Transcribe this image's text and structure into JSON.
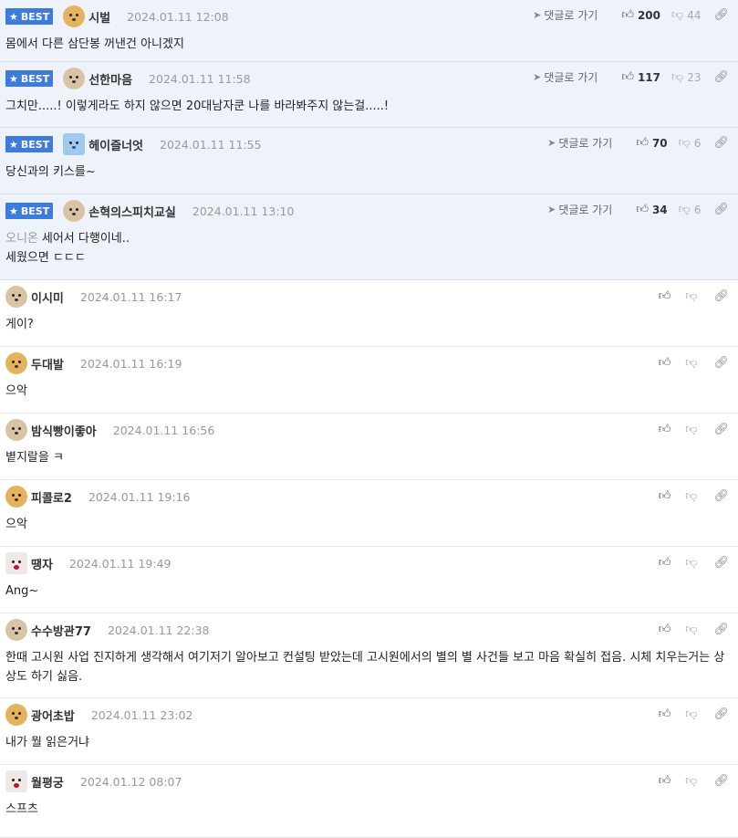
{
  "best_label": "BEST",
  "reply_label": "댓글로 가기",
  "comments": [
    {
      "best": true,
      "nick": "시벌",
      "date": "2024.01.11 12:08",
      "up": "200",
      "down": "44",
      "text": "몸에서 다른 삼단봉 꺼낸건 아니겠지",
      "avatar": "fox"
    },
    {
      "best": true,
      "nick": "선한마음",
      "date": "2024.01.11 11:58",
      "up": "117",
      "down": "23",
      "text": "그치만.....! 이렇게라도 하지 않으면 20대남자쿤 나를 바라봐주지 않는걸.....!",
      "avatar": "dog"
    },
    {
      "best": true,
      "nick": "헤이즐너엇",
      "date": "2024.01.11 11:55",
      "up": "70",
      "down": "6",
      "text": "당신과의 키스를~",
      "avatar": "blue"
    },
    {
      "best": true,
      "nick": "손혁의스피치교실",
      "date": "2024.01.11 13:10",
      "up": "34",
      "down": "6",
      "mention": "오니온",
      "text": "세어서 다행이네..",
      "text2": "세웠으면 ㄷㄷㄷ",
      "avatar": "dog"
    },
    {
      "best": false,
      "nick": "이시미",
      "date": "2024.01.11 16:17",
      "text": "게이?",
      "avatar": "dog"
    },
    {
      "best": false,
      "nick": "두대발",
      "date": "2024.01.11 16:19",
      "text": "으악",
      "avatar": "fox"
    },
    {
      "best": false,
      "nick": "밤식빵이좋아",
      "date": "2024.01.11 16:56",
      "text": "볕지랄을 ㅋ",
      "avatar": "dog"
    },
    {
      "best": false,
      "nick": "피콜로2",
      "date": "2024.01.11 19:16",
      "text": "으악",
      "avatar": "fox"
    },
    {
      "best": false,
      "nick": "땡자",
      "date": "2024.01.11 19:49",
      "text": "Ang~",
      "avatar": "red"
    },
    {
      "best": false,
      "nick": "수수방관77",
      "date": "2024.01.11 22:38",
      "text": "한때 고시원 사업 진지하게 생각해서 여기저기 알아보고 컨설팅 받았는데 고시원에서의 별의 별 사건들 보고 마음 확실히 접음. 시체 치우는거는 상상도 하기 싫음.",
      "avatar": "dog"
    },
    {
      "best": false,
      "nick": "광어초밥",
      "date": "2024.01.11 23:02",
      "text": "내가 뭘 읽은거냐",
      "avatar": "fox"
    },
    {
      "best": false,
      "nick": "월평궁",
      "date": "2024.01.12 08:07",
      "text": "스프츠",
      "avatar": "red"
    }
  ]
}
